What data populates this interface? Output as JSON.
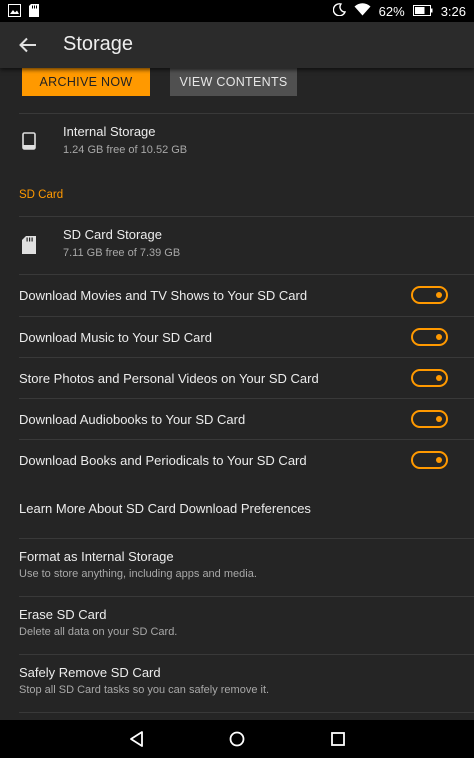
{
  "status_bar": {
    "battery_percent": "62%",
    "time": "3:26",
    "icons": [
      "image-icon",
      "sd-card-notification-icon",
      "moon-icon",
      "wifi-icon",
      "battery-icon"
    ]
  },
  "app_bar": {
    "title": "Storage",
    "back_icon": "arrow-left-icon"
  },
  "actions": {
    "archive_now_label": "ARCHIVE NOW",
    "view_contents_label": "VIEW CONTENTS"
  },
  "internal_storage": {
    "title": "Internal Storage",
    "detail": "1.24 GB free of 10.52 GB",
    "icon": "phone-icon"
  },
  "sd_card": {
    "section_title": "SD Card",
    "storage_title": "SD Card Storage",
    "storage_detail": "7.11 GB free of 7.39 GB",
    "icon": "sd-card-icon",
    "toggles": [
      {
        "label": "Download Movies and TV Shows to Your SD Card",
        "on": true
      },
      {
        "label": "Download Music to Your SD Card",
        "on": true
      },
      {
        "label": "Store Photos and Personal Videos on Your SD Card",
        "on": true
      },
      {
        "label": "Download Audiobooks to Your SD Card",
        "on": true
      },
      {
        "label": "Download Books and Periodicals to Your SD Card",
        "on": true
      }
    ],
    "learn_more": "Learn More About SD Card Download Preferences",
    "options": [
      {
        "title": "Format as Internal Storage",
        "detail": "Use to store anything, including apps and media."
      },
      {
        "title": "Erase SD Card",
        "detail": "Delete all data on your SD Card."
      },
      {
        "title": "Safely Remove SD Card",
        "detail": "Stop all SD Card tasks so you can safely remove it."
      }
    ]
  },
  "nav_bar": {
    "icons": [
      "back-triangle-icon",
      "home-circle-icon",
      "recents-square-icon"
    ]
  },
  "colors": {
    "accent": "#ff9900",
    "background": "#252525",
    "app_bar": "#2b2b2b",
    "secondary_button": "#505050"
  }
}
